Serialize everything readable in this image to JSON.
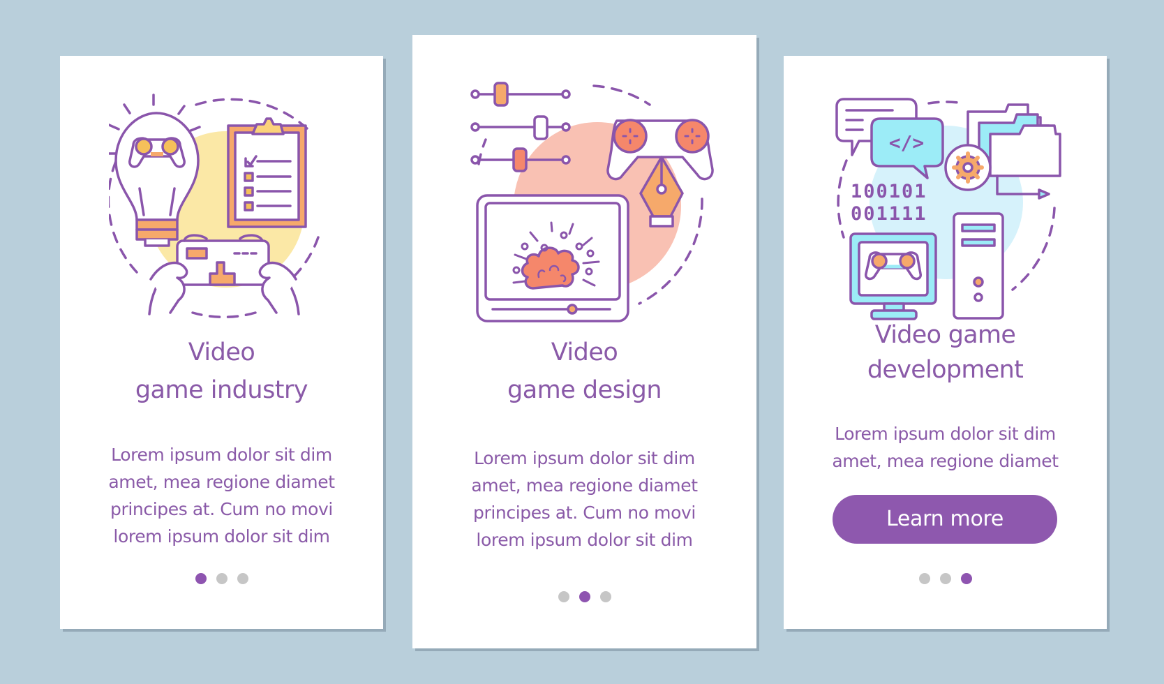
{
  "colors": {
    "background": "#b9cfdb",
    "card": "#ffffff",
    "text": "#8a5aa8",
    "accent": "#8e58ae",
    "dot_active": "#8e54b0",
    "dot_inactive": "#c6c6c6",
    "outline": "#8a55ab",
    "orange": "#f6a96b",
    "yellow_blob": "#fbe8a6",
    "salmon": "#f5876b",
    "pink_blob": "#f9c1b3",
    "cyan": "#9cecf7",
    "blue_blob": "#d6f2fb"
  },
  "cards": [
    {
      "title_lines": [
        "Video",
        "game industry"
      ],
      "body_lines": [
        "Lorem ipsum dolor sit dim",
        "amet, mea regione diamet",
        "principes at. Cum no movi",
        "lorem ipsum dolor sit dim"
      ],
      "illustration": [
        "lightbulb-gamepad-icon",
        "clipboard-checklist-icon",
        "hands-holding-phone-icon"
      ],
      "page_indicator": {
        "current": 1,
        "total": 3
      }
    },
    {
      "title_lines": [
        "Video",
        "game design"
      ],
      "body_lines": [
        "Lorem ipsum dolor sit dim",
        "amet, mea regione diamet",
        "principes at. Cum no movi",
        "lorem ipsum dolor sit dim"
      ],
      "illustration": [
        "sliders-icon",
        "gamepad-icon",
        "pen-nib-icon",
        "tablet-explosion-icon"
      ],
      "page_indicator": {
        "current": 2,
        "total": 3
      }
    },
    {
      "title_lines": [
        "Video game",
        "development"
      ],
      "body_lines": [
        "Lorem ipsum dolor sit dim",
        "amet, mea regione diamet"
      ],
      "button_label": "Learn more",
      "binary_lines": [
        "100101",
        "001111"
      ],
      "code_symbol": "</>",
      "illustration": [
        "chat-bubbles-code-icon",
        "folders-gear-icon",
        "binary-code-icon",
        "monitor-gamepad-icon",
        "pc-tower-icon"
      ],
      "page_indicator": {
        "current": 3,
        "total": 3
      }
    }
  ]
}
